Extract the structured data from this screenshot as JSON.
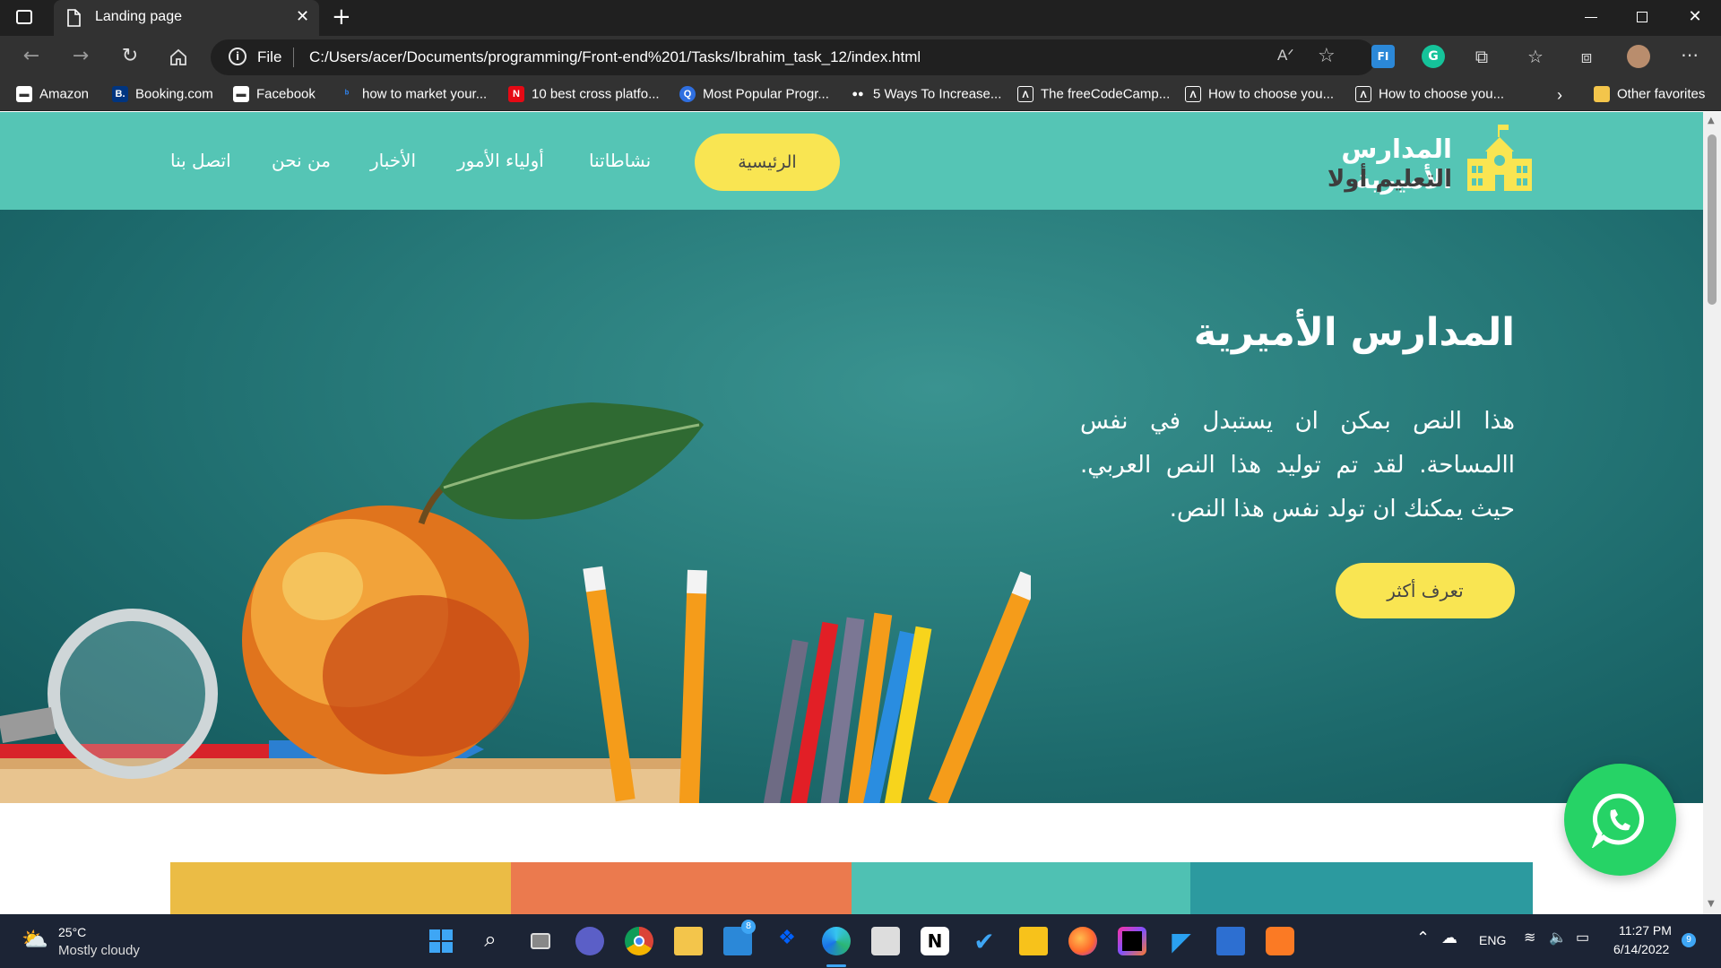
{
  "browser": {
    "tab_title": "Landing page",
    "address": {
      "scheme_label": "File",
      "url": "C:/Users/acer/Documents/programming/Front-end%201/Tasks/Ibrahim_task_12/index.html"
    },
    "favorites": [
      {
        "label": "Amazon",
        "icon": "amazon-icon"
      },
      {
        "label": "Booking.com",
        "icon": "booking-icon"
      },
      {
        "label": "Facebook",
        "icon": "facebook-icon"
      },
      {
        "label": "how to market your...",
        "icon": "bing-icon"
      },
      {
        "label": "10 best cross platfo...",
        "icon": "netflix-icon"
      },
      {
        "label": "Most Popular Progr...",
        "icon": "q-icon"
      },
      {
        "label": "5 Ways To Increase...",
        "icon": "medium-icon"
      },
      {
        "label": "The freeCodeCamp...",
        "icon": "freecodecamp-icon"
      },
      {
        "label": "How to choose you...",
        "icon": "freecodecamp-icon"
      },
      {
        "label": "How to choose you...",
        "icon": "freecodecamp-icon"
      }
    ],
    "other_favorites": "Other favorites"
  },
  "site": {
    "logo_title": "المدارس الأميرية",
    "logo_subtitle": "التعليم أولا",
    "nav": {
      "home": "الرئيسية",
      "activities": "نشاطاتنا",
      "parents": "أولياء الأمور",
      "news": "الأخبار",
      "about": "من نحن",
      "contact": "اتصل بنا"
    },
    "hero": {
      "title": "المدارس الأميرية",
      "text": "هذا النص بمكن ان يستبدل في نفس االمساحة. لقد تم توليد هذا النص العربي. حيث يمكنك ان تولد نفس هذا النص.",
      "button": "تعرف أكثر"
    },
    "color_bars": [
      "#ebbc45",
      "#eb7a4e",
      "#4fc1b3",
      "#2c9a9f"
    ],
    "accent": "#f9e552",
    "header_bg": "#55c5b5"
  },
  "taskbar": {
    "weather_temp": "25°C",
    "weather_desc": "Mostly cloudy",
    "mail_badge": "8",
    "language": "ENG",
    "time": "11:27 PM",
    "date": "6/14/2022",
    "notifications": "9"
  }
}
